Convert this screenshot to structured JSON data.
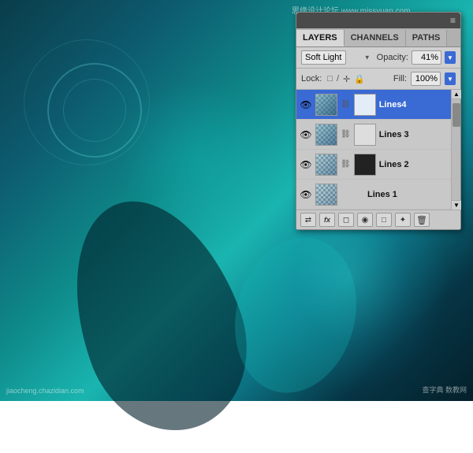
{
  "background": {
    "alt": "Digital artwork with teal/cyan underwater theme"
  },
  "watermarks": {
    "top": "思缘设计论坛 www.missyuan.com",
    "bottom_left": "jiaocheng.chazidian.com",
    "bottom_right": "查字典 数教网"
  },
  "panel": {
    "menu_icon": "≡",
    "tabs": [
      {
        "label": "LAYERS",
        "active": true
      },
      {
        "label": "CHANNELS",
        "active": false
      },
      {
        "label": "PATHS",
        "active": false
      }
    ],
    "blend_mode": {
      "value": "Soft Light",
      "label": "Soft Light"
    },
    "opacity": {
      "label": "Opacity:",
      "value": "41%",
      "arrow": "▼"
    },
    "lock": {
      "label": "Lock:",
      "icons": [
        "□",
        "/",
        "✛",
        "🔒"
      ]
    },
    "fill": {
      "label": "Fill:",
      "value": "100%",
      "arrow": "▼"
    },
    "layers": [
      {
        "name": "Lines4",
        "visible": true,
        "selected": true,
        "has_mask": true
      },
      {
        "name": "Lines 3",
        "visible": true,
        "selected": false,
        "has_mask": true
      },
      {
        "name": "Lines 2",
        "visible": true,
        "selected": false,
        "has_mask": true
      },
      {
        "name": "Lines 1",
        "visible": true,
        "selected": false,
        "has_mask": false
      }
    ],
    "toolbar": {
      "buttons": [
        {
          "icon": "⇄",
          "name": "link-icon"
        },
        {
          "icon": "fx",
          "name": "effects-icon"
        },
        {
          "icon": "◻",
          "name": "mask-icon"
        },
        {
          "icon": "◉",
          "name": "adjustment-icon"
        },
        {
          "icon": "□",
          "name": "group-icon"
        },
        {
          "icon": "✦",
          "name": "new-layer-icon"
        },
        {
          "icon": "🗑",
          "name": "delete-icon"
        }
      ]
    }
  }
}
